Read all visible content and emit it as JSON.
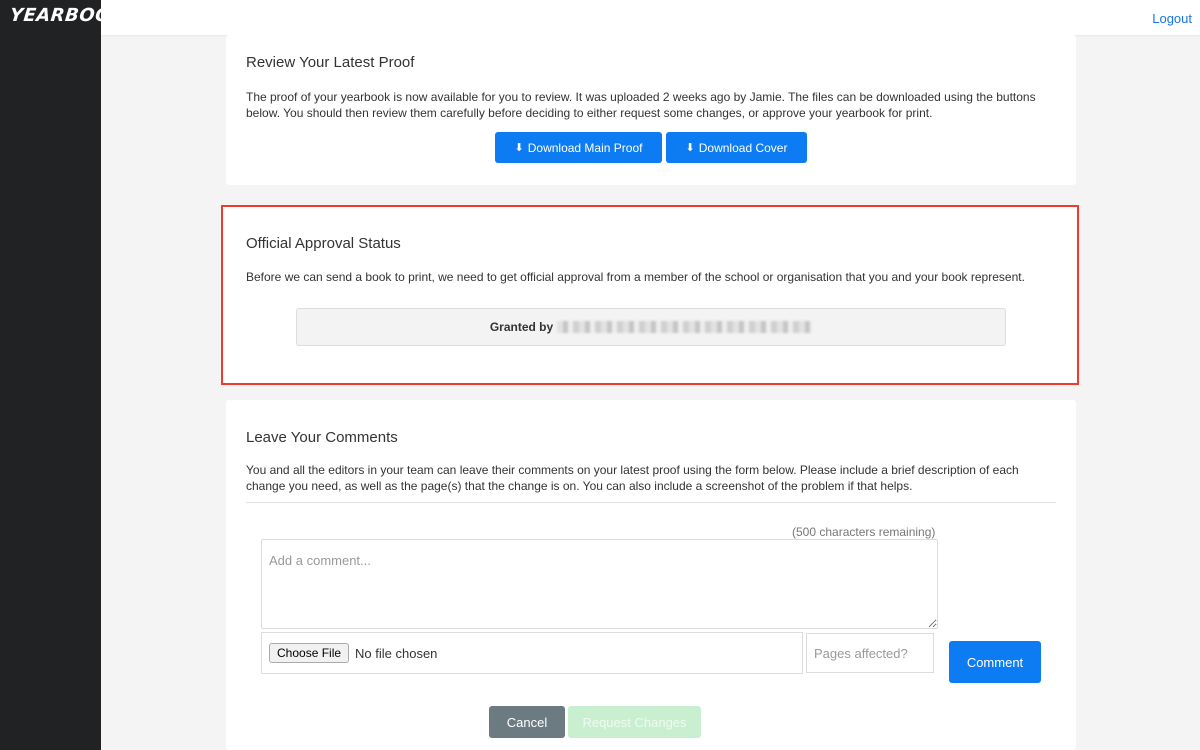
{
  "app": {
    "logo": "YEARBOOK",
    "logout_label": "Logout"
  },
  "proof": {
    "title": "Review Your Latest Proof",
    "description": "The proof of your yearbook is now available for you to review. It was uploaded 2 weeks ago by Jamie. The files can be downloaded using the buttons below. You should then review them carefully before deciding to either request some changes, or approve your yearbook for print.",
    "download_main_label": "Download Main Proof",
    "download_cover_label": "Download Cover",
    "download_icon": "download-icon"
  },
  "approval": {
    "title": "Official Approval Status",
    "description": "Before we can send a book to print, we need to get official approval from a member of the school or organisation that you and your book represent.",
    "granted_label": "Granted by",
    "highlight_color": "#ef3b2b"
  },
  "comments": {
    "title": "Leave Your Comments",
    "description": "You and all the editors in your team can leave their comments on your latest proof using the form below. Please include a brief description of each change you need, as well as the page(s) that the change is on. You can also include a screenshot of the problem if that helps.",
    "remaining_text": "(500 characters remaining)",
    "comment_placeholder": "Add a comment...",
    "choose_file_label": "Choose File",
    "no_file_text": "No file chosen",
    "pages_placeholder": "Pages affected?",
    "comment_button_label": "Comment",
    "cancel_label": "Cancel",
    "request_changes_label": "Request Changes"
  },
  "colors": {
    "primary": "#0d7cf2",
    "sidebar": "#212224",
    "cancel": "#6c7a82",
    "request_disabled": "#c8efd0"
  }
}
